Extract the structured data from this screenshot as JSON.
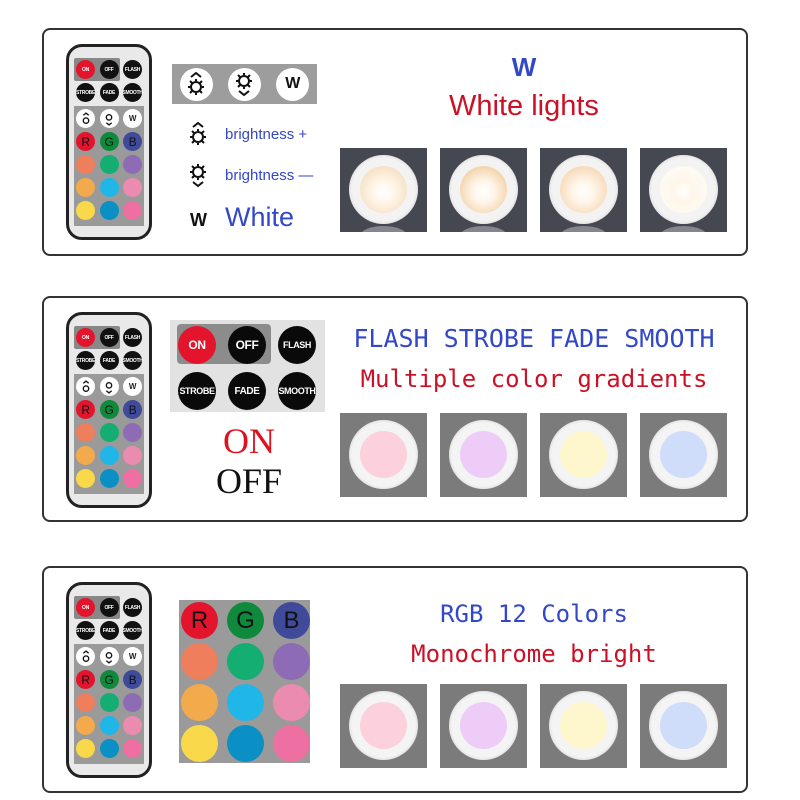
{
  "panels": [
    {
      "id": "white-lights",
      "remote": {
        "row1": [
          "ON",
          "OFF",
          "FLASH"
        ],
        "row2": [
          "STROBE",
          "FADE",
          "SMOOTH"
        ],
        "row3_icons": [
          "brightness-up-icon",
          "brightness-down-icon",
          "W"
        ],
        "rgb": [
          "R",
          "G",
          "B"
        ]
      },
      "key_strip": {
        "labels": [
          "brightness-up",
          "brightness-down",
          "W"
        ]
      },
      "legend": [
        {
          "icon": "brightness-up-icon",
          "text": "brightness +"
        },
        {
          "icon": "brightness-down-icon",
          "text": "brightness —"
        },
        {
          "icon": "W",
          "text": "White"
        }
      ],
      "heading": "W",
      "subheading": "White lights",
      "lamps": [
        {
          "tone": "warm-white",
          "color": "#f6e3c8"
        },
        {
          "tone": "warm",
          "color": "#f4d6b0"
        },
        {
          "tone": "soft-warm",
          "color": "#f8dcbc"
        },
        {
          "tone": "cool-white",
          "color": "#fdfbf3"
        }
      ]
    },
    {
      "id": "modes",
      "remote": {
        "row1": [
          "ON",
          "OFF",
          "FLASH"
        ],
        "row2": [
          "STROBE",
          "FADE",
          "SMOOTH"
        ],
        "row3_icons": [
          "brightness-up-icon",
          "brightness-down-icon",
          "W"
        ],
        "rgb": [
          "R",
          "G",
          "B"
        ]
      },
      "key_strip": {
        "row1": [
          "ON",
          "OFF",
          "FLASH"
        ],
        "row2": [
          "STROBE",
          "FADE",
          "SMOOTH"
        ]
      },
      "onoff": {
        "on": "ON",
        "off": "OFF"
      },
      "heading": "FLASH STROBE FADE SMOOTH",
      "subheading": "Multiple color gradients",
      "lamps": [
        {
          "tone": "pink",
          "color": "#fcd0dc"
        },
        {
          "tone": "lavender",
          "color": "#edcdf8"
        },
        {
          "tone": "pale-yellow",
          "color": "#fef6cc"
        },
        {
          "tone": "pale-blue",
          "color": "#cfdcfa"
        }
      ]
    },
    {
      "id": "rgb",
      "remote": {
        "row1": [
          "ON",
          "OFF",
          "FLASH"
        ],
        "row2": [
          "STROBE",
          "FADE",
          "SMOOTH"
        ],
        "row3_icons": [
          "brightness-up-icon",
          "brightness-down-icon",
          "W"
        ],
        "rgb": [
          "R",
          "G",
          "B"
        ]
      },
      "color_grid": {
        "labels": [
          "R",
          "G",
          "B"
        ],
        "colors": [
          [
            "#e3142c",
            "#0f8a3c",
            "#3f4a9b"
          ],
          [
            "#ee7e5c",
            "#14ad72",
            "#8e6cb5"
          ],
          [
            "#f2aa4c",
            "#20b6e8",
            "#ec8bb0"
          ],
          [
            "#f9d84a",
            "#0a90c4",
            "#ee6fa1"
          ]
        ]
      },
      "heading": "RGB 12 Colors",
      "subheading": "Monochrome bright",
      "lamps": [
        {
          "tone": "pink",
          "color": "#fcd0dc"
        },
        {
          "tone": "lavender",
          "color": "#edcdf8"
        },
        {
          "tone": "pale-yellow",
          "color": "#fef6cc"
        },
        {
          "tone": "pale-blue",
          "color": "#cfdcfa"
        }
      ]
    }
  ],
  "palette": {
    "remote_colors": [
      [
        "#ee7e5c",
        "#14ad72",
        "#8e6cb5"
      ],
      [
        "#f2aa4c",
        "#20b6e8",
        "#ec8bb0"
      ],
      [
        "#f9d84a",
        "#0a90c4",
        "#ee6fa1"
      ]
    ],
    "rgb_colors": [
      "#e3142c",
      "#0f8a3c",
      "#3f4a9b"
    ],
    "heading_blue": "#3347c9",
    "heading_red": "#cc1126"
  }
}
